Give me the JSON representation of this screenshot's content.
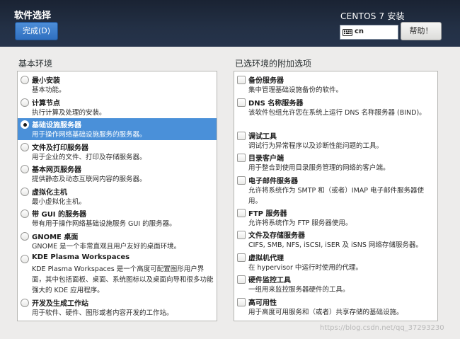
{
  "header": {
    "title": "软件选择",
    "done_label": "完成(D)",
    "product": "CENTOS 7 安装",
    "keyboard_layout": "cn",
    "help_label": "帮助！"
  },
  "base_env": {
    "heading": "基本环境",
    "items": [
      {
        "title": "最小安装",
        "desc": "基本功能。",
        "selected": false
      },
      {
        "title": "计算节点",
        "desc": "执行计算及处理的安装。",
        "selected": false
      },
      {
        "title": "基础设施服务器",
        "desc": "用于操作网络基础设施服务的服务器。",
        "selected": true
      },
      {
        "title": "文件及打印服务器",
        "desc": "用于企业的文件、打印及存储服务器。",
        "selected": false
      },
      {
        "title": "基本网页服务器",
        "desc": "提供静态及动态互联网内容的服务器。",
        "selected": false
      },
      {
        "title": "虚拟化主机",
        "desc": "最小虚拟化主机。",
        "selected": false
      },
      {
        "title": "带 GUI 的服务器",
        "desc": "带有用于操作网络基础设施服务 GUI 的服务器。",
        "selected": false
      },
      {
        "title": "GNOME 桌面",
        "desc": "GNOME 是一个非常直观且用户友好的桌面环境。",
        "selected": false
      },
      {
        "title": "KDE Plasma Workspaces",
        "desc": "KDE Plasma Workspaces 是一个高度可配置图形用户界面，其中包括面板、桌面、系统图标以及桌面向导和很多功能强大的 KDE 应用程序。",
        "selected": false
      },
      {
        "title": "开发及生成工作站",
        "desc": "用于软件、硬件、图形或者内容开发的工作站。",
        "selected": false
      }
    ]
  },
  "addons": {
    "heading": "已选环境的附加选项",
    "items": [
      {
        "title": "备份服务器",
        "desc": "集中管理基础设施备份的软件。"
      },
      {
        "title": "DNS 名称服务器",
        "desc": "该软件包组允许您在系统上运行 DNS 名称服务器 (BIND)。"
      },
      {
        "title": "调试工具",
        "desc": "调试行为异常程序以及诊断性能问题的工具。"
      },
      {
        "title": "目录客户端",
        "desc": "用于整合到使用目录服务管理的网络的客户端。"
      },
      {
        "title": "电子邮件服务器",
        "desc": "允许将系统作为 SMTP 和（或者）IMAP 电子邮件服务器使用。"
      },
      {
        "title": "FTP 服务器",
        "desc": "允许将系统作为 FTP 服务器使用。"
      },
      {
        "title": "文件及存储服务器",
        "desc": "CIFS, SMB, NFS, iSCSI, iSER 及 iSNS 网络存储服务器。"
      },
      {
        "title": "虚拟机代理",
        "desc": "在 hypervisor 中运行时使用的代理。"
      },
      {
        "title": "硬件监控工具",
        "desc": "一组用来监控服务器硬件的工具。"
      },
      {
        "title": "高可用性",
        "desc": "用于高度可用服务和（或者）共享存储的基础设施。"
      }
    ]
  },
  "watermark": "https://blog.csdn.net/qq_37293230"
}
